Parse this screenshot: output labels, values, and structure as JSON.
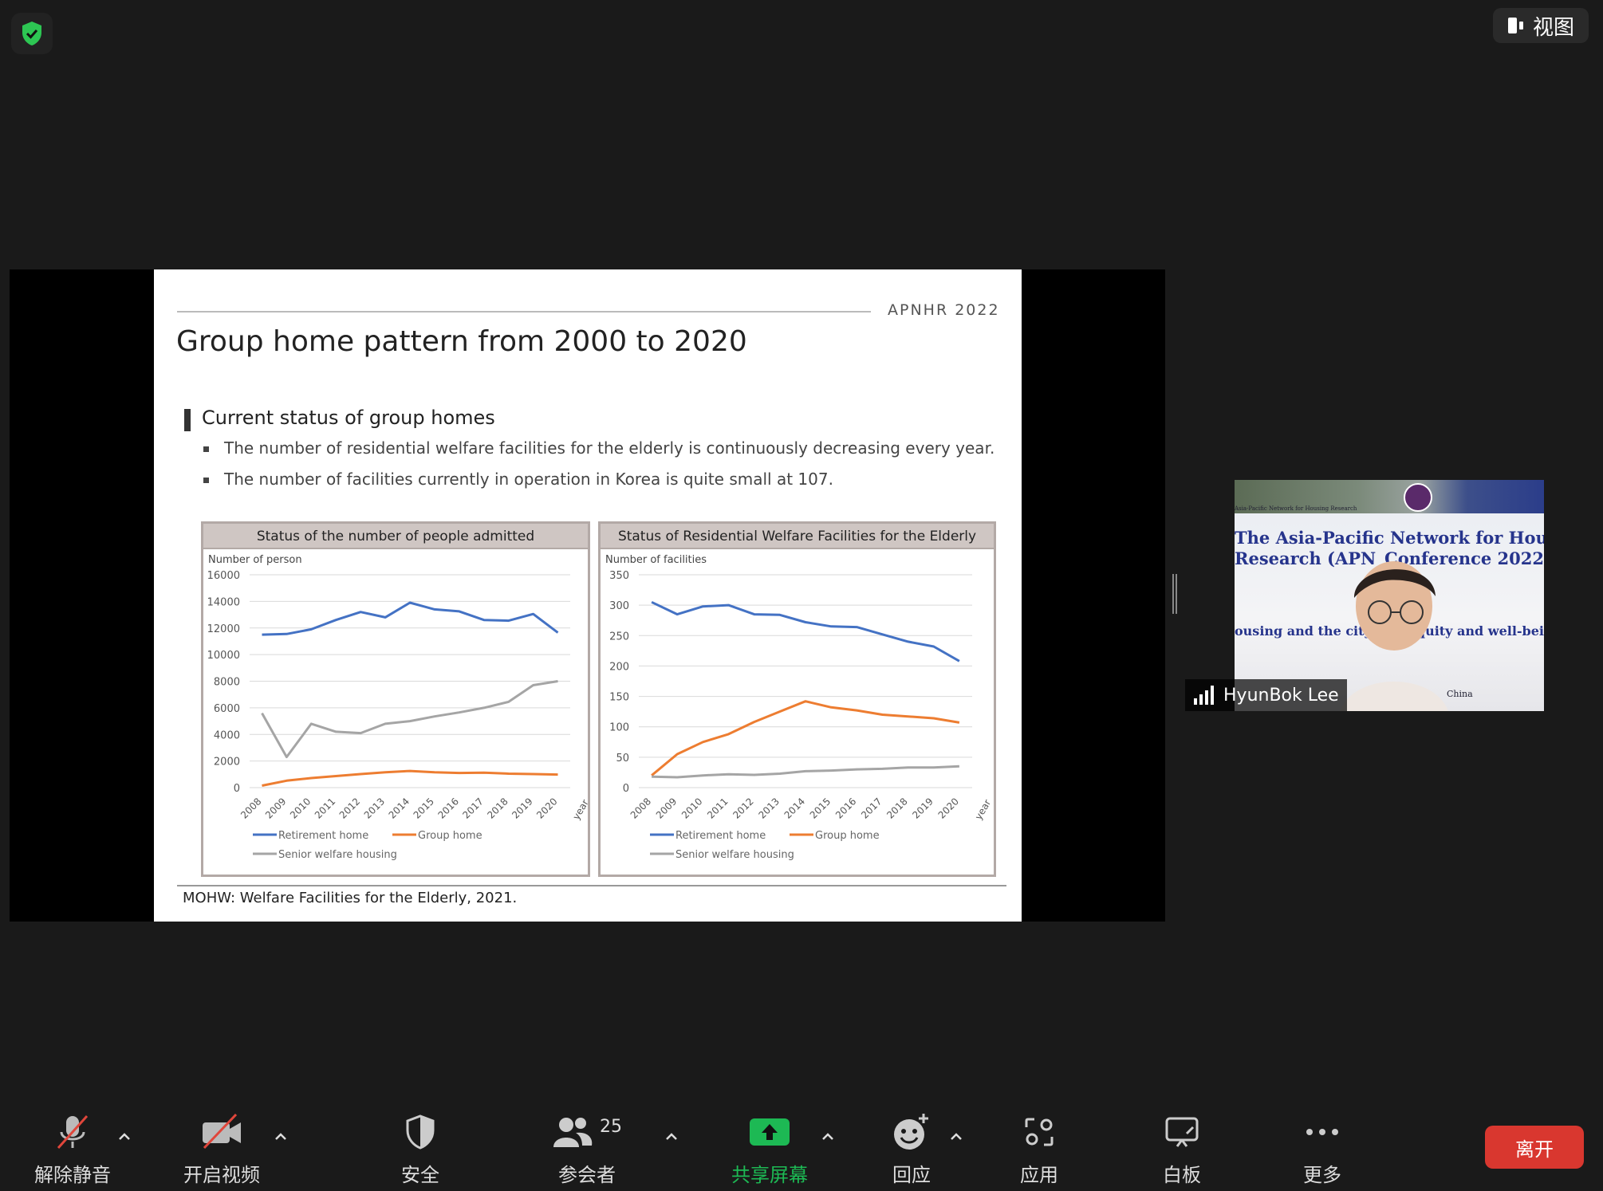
{
  "top_bar": {
    "view_label": "视图"
  },
  "slide": {
    "tag": "APNHR  2022",
    "title": "Group home pattern from 2000 to 2020",
    "section_title": "Current status of group homes",
    "bullets": [
      "The number of residential welfare facilities for the elderly is continuously decreasing every year.",
      "The number of facilities currently in operation in Korea is quite small at 107."
    ],
    "source": "MOHW: Welfare Facilities for the Elderly, 2021."
  },
  "chart_data": [
    {
      "type": "line",
      "title": "Status of the number of people admitted",
      "ylabel": "Number of person",
      "xlabel": "year",
      "x": [
        "2008",
        "2009",
        "2010",
        "2011",
        "2012",
        "2013",
        "2014",
        "2015",
        "2016",
        "2017",
        "2018",
        "2019",
        "2020"
      ],
      "ylim": [
        0,
        16000
      ],
      "yticks": [
        0,
        2000,
        4000,
        6000,
        8000,
        10000,
        12000,
        14000,
        16000
      ],
      "series": [
        {
          "name": "Retirement home",
          "color": "#4472c4",
          "values": [
            11500,
            11550,
            11900,
            12600,
            13200,
            12800,
            13900,
            13400,
            13250,
            12600,
            12550,
            13050,
            11650
          ]
        },
        {
          "name": "Group home",
          "color": "#ed7d31",
          "values": [
            150,
            520,
            720,
            870,
            1020,
            1150,
            1250,
            1150,
            1100,
            1120,
            1050,
            1020,
            980
          ]
        },
        {
          "name": "Senior welfare housing",
          "color": "#a5a5a5",
          "values": [
            5600,
            2300,
            4800,
            4200,
            4100,
            4800,
            5000,
            5350,
            5650,
            6000,
            6450,
            7700,
            8000
          ]
        }
      ],
      "legend": [
        "Retirement home",
        "Group home",
        "Senior welfare housing"
      ]
    },
    {
      "type": "line",
      "title": "Status of Residential Welfare Facilities for the Elderly",
      "ylabel": "Number of facilities",
      "xlabel": "year",
      "x": [
        "2008",
        "2009",
        "2010",
        "2011",
        "2012",
        "2013",
        "2014",
        "2015",
        "2016",
        "2017",
        "2018",
        "2019",
        "2020"
      ],
      "ylim": [
        0,
        350
      ],
      "yticks": [
        0,
        50,
        100,
        150,
        200,
        250,
        300,
        350
      ],
      "series": [
        {
          "name": "Retirement home",
          "color": "#4472c4",
          "values": [
            305,
            285,
            298,
            300,
            285,
            284,
            272,
            265,
            264,
            252,
            240,
            232,
            208
          ]
        },
        {
          "name": "Group home",
          "color": "#ed7d31",
          "values": [
            20,
            55,
            75,
            88,
            108,
            125,
            142,
            132,
            127,
            120,
            117,
            114,
            107
          ]
        },
        {
          "name": "Senior welfare housing",
          "color": "#a5a5a5",
          "values": [
            18,
            17,
            20,
            22,
            21,
            23,
            27,
            28,
            30,
            31,
            33,
            33,
            35
          ]
        }
      ],
      "legend": [
        "Retirement home",
        "Group home",
        "Senior welfare housing"
      ]
    }
  ],
  "video": {
    "participant_name": "HyunBok Lee",
    "bg_title_line1": "The Asia-Pacific Network for Housin",
    "bg_title_line2": "Research (APN",
    "bg_title_line2b": "Conference 2022",
    "bg_subtitle_a": "ousing and the city",
    "bg_subtitle_b": "equity and well-bei",
    "bg_small": "Asia-Pacific Network for Housing Research",
    "bg_china": "China"
  },
  "toolbar": {
    "unmute": "解除静音",
    "start_video": "开启视频",
    "security": "安全",
    "participants": "参会者",
    "participants_count": "25",
    "share": "共享屏幕",
    "reactions": "回应",
    "apps": "应用",
    "whiteboard": "白板",
    "more": "更多",
    "leave": "离开",
    "colors": {
      "share_green": "#1db954",
      "leave_red": "#d9372f",
      "mute_red": "#e0463b"
    }
  }
}
